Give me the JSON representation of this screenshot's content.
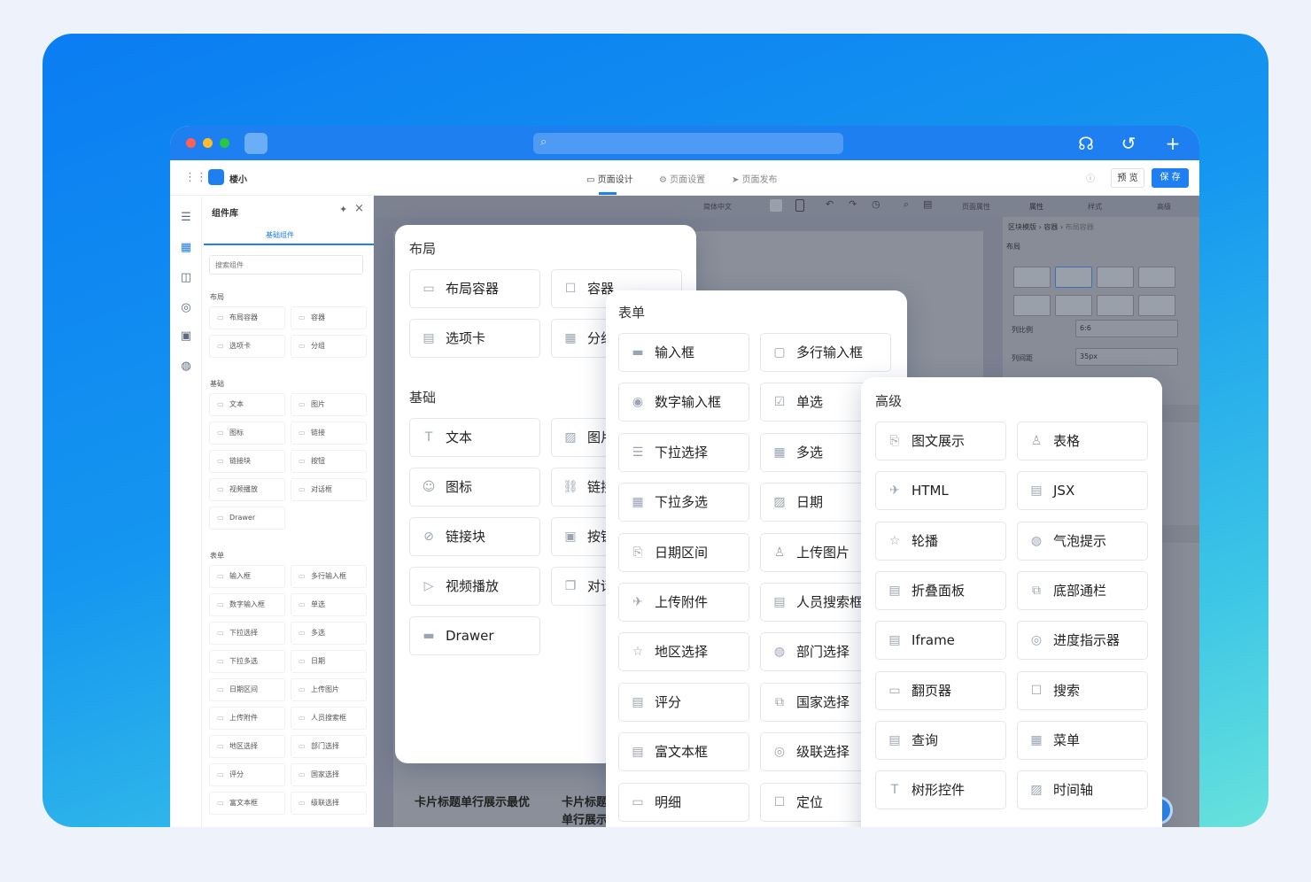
{
  "topbar": {
    "app_name": "楼小",
    "tabs": [
      "页面设计",
      "页面设置",
      "页面发布"
    ],
    "preview": "预 览",
    "save": "保 存"
  },
  "library": {
    "title": "组件库",
    "tab": "基础组件",
    "search_placeholder": "搜索组件",
    "sections": [
      {
        "title": "布局",
        "items": [
          "布局容器",
          "容器",
          "选项卡",
          "分组"
        ]
      },
      {
        "title": "基础",
        "items": [
          "文本",
          "图片",
          "图标",
          "链接",
          "链接块",
          "按钮",
          "视频播放",
          "对话框",
          "Drawer"
        ]
      },
      {
        "title": "表单",
        "items": [
          "输入框",
          "多行输入框",
          "数字输入框",
          "单选",
          "下拉选择",
          "多选",
          "下拉多选",
          "日期",
          "日期区间",
          "上传图片",
          "上传附件",
          "人员搜索框",
          "地区选择",
          "部门选择",
          "评分",
          "国家选择",
          "富文本框",
          "级联选择"
        ]
      }
    ]
  },
  "toolbar": {
    "lang": "简体中文",
    "page_props": "页面属性"
  },
  "inspector": {
    "tabs": [
      "属性",
      "样式",
      "高级"
    ],
    "breadcrumb": [
      "区块模版",
      "容器",
      "布局容器"
    ],
    "layout_label": "布局",
    "ratio_label": "列比例",
    "ratio_value": "6:6",
    "gap_label": "列间距",
    "gap_value": "35px"
  },
  "canvas": {
    "card_title_1": "卡片标题单行展示最优",
    "card_title_2": "卡片标题单行展示最优"
  },
  "card_layout": {
    "title1": "布局",
    "items1": [
      "布局容器",
      "容器",
      "选项卡",
      "分组"
    ],
    "title2": "基础",
    "items2": [
      "文本",
      "图片",
      "图标",
      "链接",
      "链接块",
      "按钮",
      "视频播放",
      "对话框",
      "Drawer"
    ]
  },
  "card_form": {
    "title": "表单",
    "items": [
      "输入框",
      "多行输入框",
      "数字输入框",
      "单选",
      "下拉选择",
      "多选",
      "下拉多选",
      "日期",
      "日期区间",
      "上传图片",
      "上传附件",
      "人员搜索框",
      "地区选择",
      "部门选择",
      "评分",
      "国家选择",
      "富文本框",
      "级联选择",
      "明细",
      "定位"
    ]
  },
  "card_adv": {
    "title": "高级",
    "items": [
      "图文展示",
      "表格",
      "HTML",
      "JSX",
      "轮播",
      "气泡提示",
      "折叠面板",
      "底部通栏",
      "Iframe",
      "进度指示器",
      "翻页器",
      "搜索",
      "查询",
      "菜单",
      "树形控件",
      "时间轴"
    ]
  },
  "colors": {
    "accent": "#1e7ff0"
  }
}
